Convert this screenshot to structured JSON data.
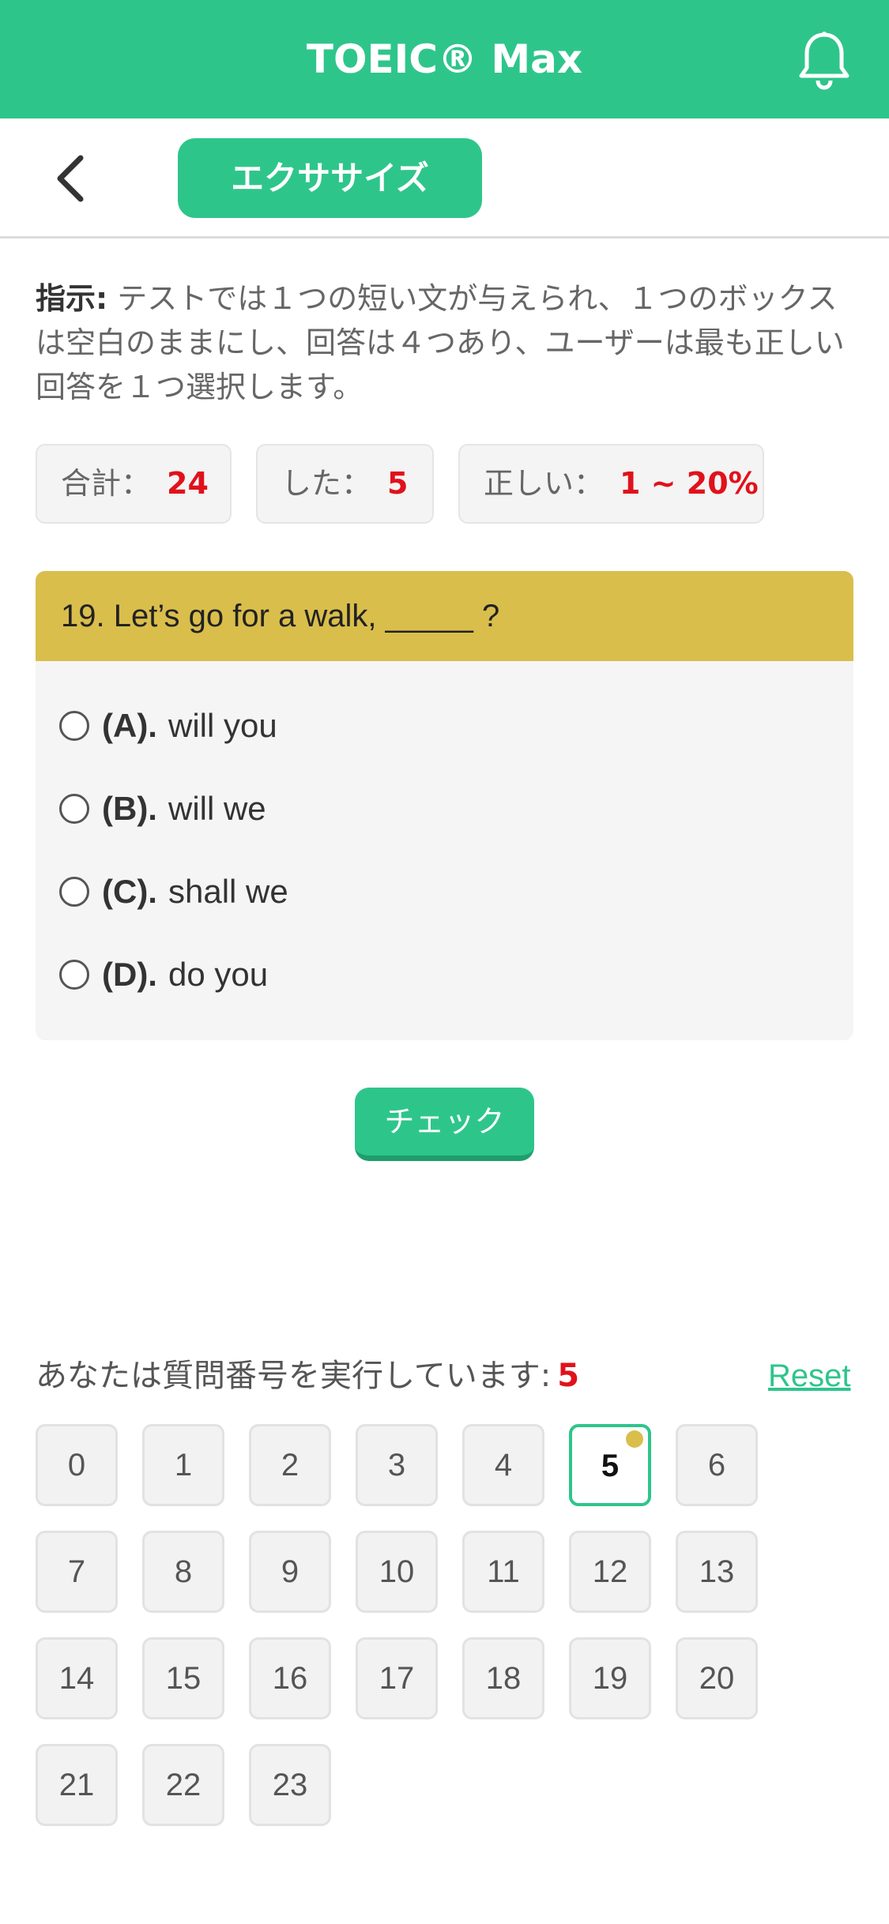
{
  "header": {
    "title": "TOEIC® Max"
  },
  "subheader": {
    "tab_label": "エクササイズ"
  },
  "instruction": {
    "label": "指示:",
    "text": "テストでは１つの短い文が与えられ、１つのボックスは空白のままにし、回答は４つあり、ユーザーは最も正しい回答を１つ選択します。"
  },
  "stats": {
    "total_label": "合計：",
    "total_value": "24",
    "done_label": "した：",
    "done_value": "5",
    "correct_label": "正しい：",
    "correct_value": "1 ~ 20%"
  },
  "question": {
    "text": "19. Let’s go for a walk, _____ ?",
    "options": [
      {
        "letter": "(A).",
        "text": "will you"
      },
      {
        "letter": "(B).",
        "text": "will we"
      },
      {
        "letter": "(C).",
        "text": "shall we"
      },
      {
        "letter": "(D).",
        "text": "do you"
      }
    ]
  },
  "check_label": "チェック",
  "progress": {
    "running_label": "あなたは質問番号を実行しています:",
    "current": "5",
    "reset_label": "Reset"
  },
  "question_numbers": [
    "0",
    "1",
    "2",
    "3",
    "4",
    "5",
    "6",
    "7",
    "8",
    "9",
    "10",
    "11",
    "12",
    "13",
    "14",
    "15",
    "16",
    "17",
    "18",
    "19",
    "20",
    "21",
    "22",
    "23"
  ],
  "active_question": "5",
  "colors": {
    "brand": "#2ec58b",
    "question_header": "#d9be4c",
    "highlight": "#e0121b"
  }
}
